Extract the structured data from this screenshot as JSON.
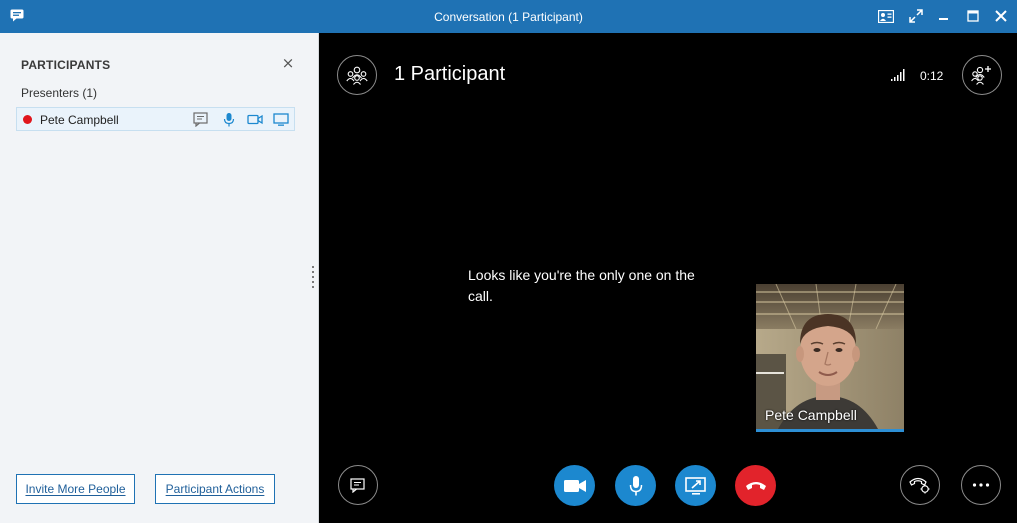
{
  "window": {
    "title": "Conversation (1 Participant)"
  },
  "participants_pane": {
    "heading": "PARTICIPANTS",
    "close_glyph": "×",
    "group_label": "Presenters (1)",
    "participants": [
      {
        "name": "Pete Campbell",
        "status_color": "#e0161d"
      }
    ],
    "invite_button": "Invite More People",
    "actions_button": "Participant Actions"
  },
  "stage": {
    "title": "1 Participant",
    "call_timer": "0:12",
    "message": "Looks like you're the only one on the call.",
    "self_view_name": "Pete Campbell"
  },
  "colors": {
    "titlebar": "#1f72b4",
    "accent_blue": "#1c88cf",
    "hangup_red": "#e2232b",
    "presence_busy": "#e0161d"
  },
  "icons": {
    "titlebar": [
      "app-chat-icon",
      "contact-card-icon",
      "fullscreen-icon",
      "minimize-icon",
      "maximize-icon",
      "close-icon"
    ],
    "participant_row": [
      "im-icon",
      "microphone-icon",
      "video-icon",
      "present-screen-icon"
    ],
    "stage_top": [
      "participants-icon",
      "signal-icon",
      "add-participant-icon"
    ],
    "stage_bottom": [
      "im-icon",
      "video-icon",
      "microphone-icon",
      "present-icon",
      "hang-up-icon",
      "call-controls-icon",
      "more-options-icon"
    ]
  }
}
